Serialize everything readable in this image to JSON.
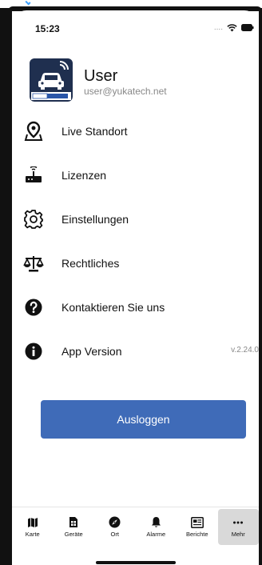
{
  "status_bar": {
    "time": "15:23",
    "signal_text": "...."
  },
  "profile": {
    "name": "User",
    "email": "user@yukatech.net",
    "logo_icon": "car-app-logo-icon"
  },
  "menu": {
    "items": [
      {
        "label": "Live Standort",
        "icon": "location-pin-icon"
      },
      {
        "label": "Lizenzen",
        "icon": "router-icon"
      },
      {
        "label": "Einstellungen",
        "icon": "gear-icon"
      },
      {
        "label": "Rechtliches",
        "icon": "scales-icon"
      },
      {
        "label": "Kontaktieren Sie uns",
        "icon": "question-circle-icon"
      },
      {
        "label": "App Version",
        "icon": "info-circle-icon",
        "value": "v.2.24.0"
      }
    ]
  },
  "logout": {
    "label": "Ausloggen",
    "color": "#3f6bb8"
  },
  "tabbar": {
    "tabs": [
      {
        "label": "Karte",
        "icon": "map-icon"
      },
      {
        "label": "Geräte",
        "icon": "sim-card-icon"
      },
      {
        "label": "Ort",
        "icon": "compass-icon"
      },
      {
        "label": "Alarme",
        "icon": "bell-icon"
      },
      {
        "label": "Berichte",
        "icon": "report-icon"
      },
      {
        "label": "Mehr",
        "icon": "more-dots-icon",
        "active": true
      }
    ]
  }
}
